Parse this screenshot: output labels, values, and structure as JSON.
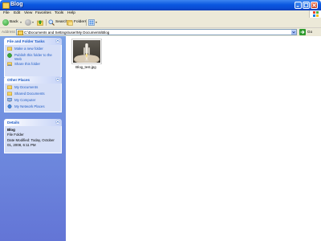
{
  "window": {
    "title": "Blog"
  },
  "menu": [
    "File",
    "Edit",
    "View",
    "Favorites",
    "Tools",
    "Help"
  ],
  "toolbar": {
    "back_label": "Back",
    "search_label": "Search",
    "folders_label": "Folders"
  },
  "address": {
    "label": "Address",
    "path": "C:\\Documents and Settings\\user\\My Documents\\Blog",
    "go_label": "Go"
  },
  "file_tasks": {
    "title": "File and Folder Tasks",
    "items": [
      {
        "label": "Make a new folder",
        "icon": "new-folder-icon"
      },
      {
        "label": "Publish this folder to the Web",
        "icon": "publish-web-icon"
      },
      {
        "label": "Share this folder",
        "icon": "share-folder-icon"
      }
    ]
  },
  "other_places": {
    "title": "Other Places",
    "items": [
      {
        "label": "My Documents",
        "icon": "my-documents-icon"
      },
      {
        "label": "Shared Documents",
        "icon": "shared-documents-icon"
      },
      {
        "label": "My Computer",
        "icon": "my-computer-icon"
      },
      {
        "label": "My Network Places",
        "icon": "network-places-icon"
      }
    ]
  },
  "details": {
    "title": "Details",
    "name": "Blog",
    "type": "File Folder",
    "modified": "Date Modified: Today, October 01, 2008, 6:11 PM"
  },
  "files": [
    {
      "name": "Blog_test.jpg"
    }
  ],
  "colors": {
    "titlebar": "#0a58e0",
    "taskpane": "#7ba2e7",
    "link": "#215dc6"
  }
}
